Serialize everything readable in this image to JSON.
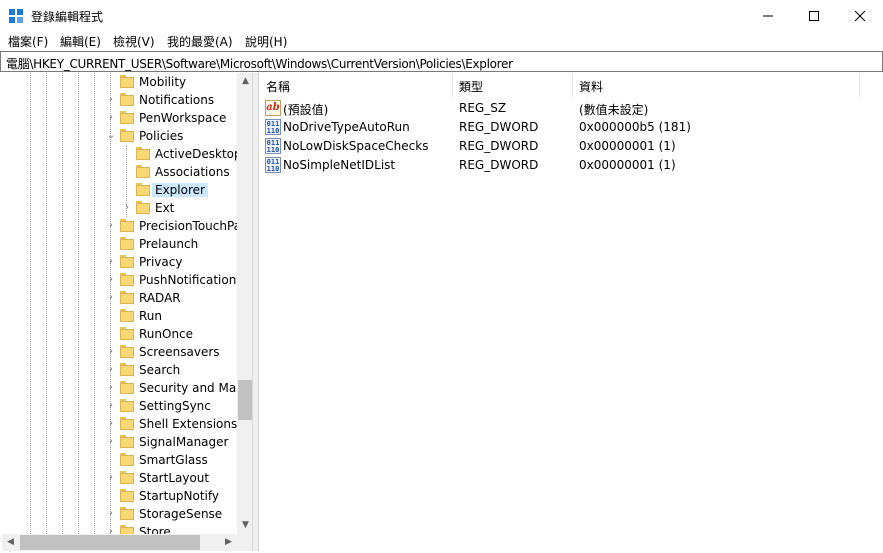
{
  "window": {
    "title": "登錄編輯程式",
    "minimize_glyph": "—",
    "maximize_glyph": "☐",
    "close_glyph": "✕"
  },
  "menu": [
    "檔案(F)",
    "編輯(E)",
    "檢視(V)",
    "我的最愛(A)",
    "說明(H)"
  ],
  "address": "電腦\\HKEY_CURRENT_USER\\Software\\Microsoft\\Windows\\CurrentVersion\\Policies\\Explorer",
  "tree": {
    "items": [
      {
        "label": "Mobility",
        "expander": ""
      },
      {
        "label": "Notifications",
        "expander": "›"
      },
      {
        "label": "PenWorkspace",
        "expander": "›"
      },
      {
        "label": "Policies",
        "expander": "⌄"
      },
      {
        "label": "ActiveDesktop",
        "expander": ""
      },
      {
        "label": "Associations",
        "expander": ""
      },
      {
        "label": "Explorer",
        "expander": ""
      },
      {
        "label": "Ext",
        "expander": "›"
      },
      {
        "label": "PrecisionTouchPa",
        "expander": "›"
      },
      {
        "label": "Prelaunch",
        "expander": ""
      },
      {
        "label": "Privacy",
        "expander": "›"
      },
      {
        "label": "PushNotifications",
        "expander": "›"
      },
      {
        "label": "RADAR",
        "expander": "›"
      },
      {
        "label": "Run",
        "expander": ""
      },
      {
        "label": "RunOnce",
        "expander": ""
      },
      {
        "label": "Screensavers",
        "expander": "›"
      },
      {
        "label": "Search",
        "expander": "›"
      },
      {
        "label": "Security and Mai",
        "expander": "›"
      },
      {
        "label": "SettingSync",
        "expander": "›"
      },
      {
        "label": "Shell Extensions",
        "expander": "›"
      },
      {
        "label": "SignalManager",
        "expander": "›"
      },
      {
        "label": "SmartGlass",
        "expander": ""
      },
      {
        "label": "StartLayout",
        "expander": "›"
      },
      {
        "label": "StartupNotify",
        "expander": ""
      },
      {
        "label": "StorageSense",
        "expander": "›"
      },
      {
        "label": "Store",
        "expander": "›"
      }
    ],
    "selected": "Explorer"
  },
  "list": {
    "columns": [
      "名稱",
      "類型",
      "資料"
    ],
    "rows": [
      {
        "name": "(預設值)",
        "type": "REG_SZ",
        "data": "(數值未設定)",
        "icon": "ab-icon"
      },
      {
        "name": "NoDriveTypeAutoRun",
        "type": "REG_DWORD",
        "data": "0x000000b5 (181)",
        "icon": "binary-icon"
      },
      {
        "name": "NoLowDiskSpaceChecks",
        "type": "REG_DWORD",
        "data": "0x00000001 (1)",
        "icon": "binary-icon"
      },
      {
        "name": "NoSimpleNetIDList",
        "type": "REG_DWORD",
        "data": "0x00000001 (1)",
        "icon": "binary-icon"
      }
    ]
  },
  "icons": {
    "ab_glyph": "ab",
    "binary_glyph": "011\n110",
    "scroll_up": "▲",
    "scroll_down": "▼",
    "scroll_left": "◀",
    "scroll_right": "▶"
  },
  "colors": {
    "selection": "#cce8ff",
    "folder": "#f8d775",
    "accent": "#1e78d7"
  }
}
